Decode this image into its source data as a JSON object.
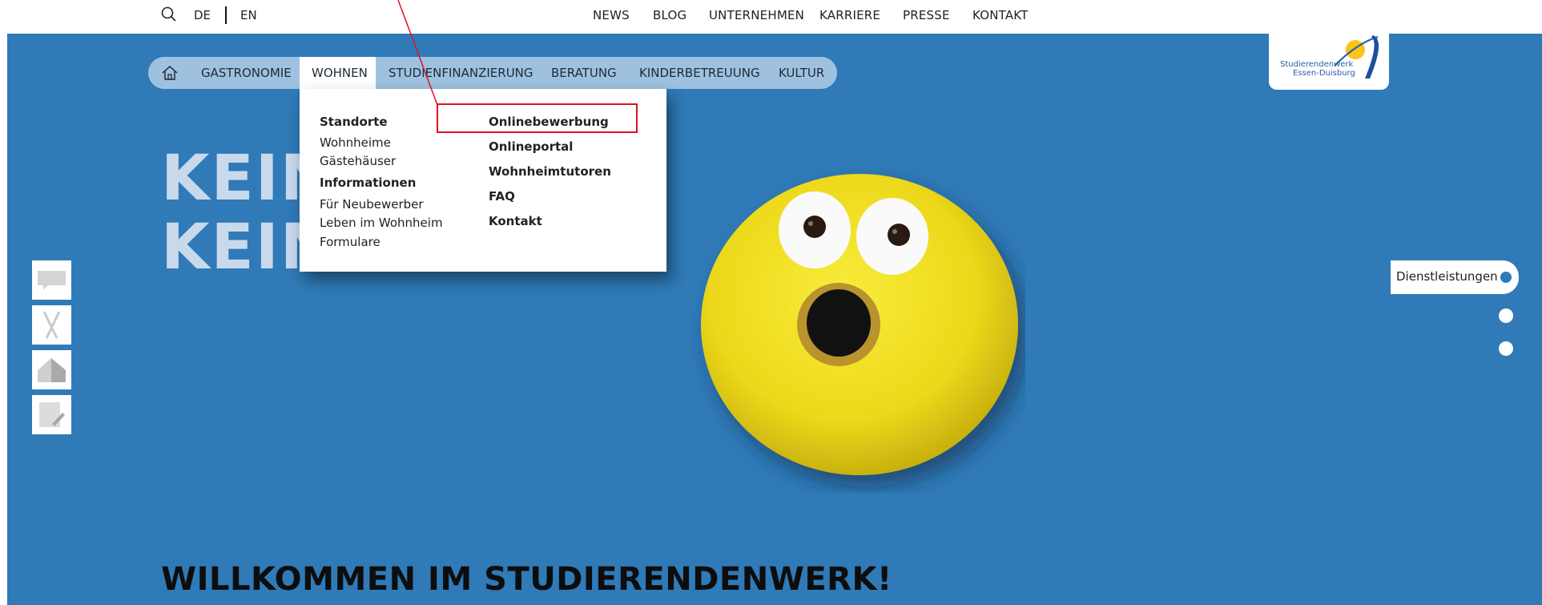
{
  "topbar": {
    "lang_de": "DE",
    "lang_en": "EN",
    "links": [
      "NEWS",
      "BLOG",
      "UNTERNEHMEN",
      "KARRIERE",
      "PRESSE",
      "KONTAKT"
    ]
  },
  "mainnav": {
    "items": [
      "GASTRONOMIE",
      "WOHNEN",
      "STUDIENFINANZIERUNG",
      "BERATUNG",
      "KINDERBETREUUNG",
      "KULTUR"
    ],
    "active": "WOHNEN"
  },
  "dropdown": {
    "col1": {
      "heading1": "Standorte",
      "links1": [
        "Wohnheime",
        "Gästehäuser"
      ],
      "heading2": "Informationen",
      "links2": [
        "Für Neubewerber",
        "Leben im Wohnheim",
        "Formulare"
      ]
    },
    "col2": [
      "Onlinebewerbung",
      "Onlineportal",
      "Wohnheimtutoren",
      "FAQ",
      "Kontakt"
    ]
  },
  "hero": {
    "line1": "KEIN",
    "line2": "KEIN",
    "welcome": "WILLKOMMEN IM STUDIERENDENWERK!"
  },
  "logo": {
    "line1": "Studierendenwerk",
    "line2": "Essen-Duisburg"
  },
  "section_nav": {
    "label": "Dienstleistungen"
  },
  "colors": {
    "hero_blue": "#2f7ab7",
    "nav_pill": "#9ec1e0",
    "highlight": "#e0121f",
    "donut_yellow": "#f2e21c"
  }
}
